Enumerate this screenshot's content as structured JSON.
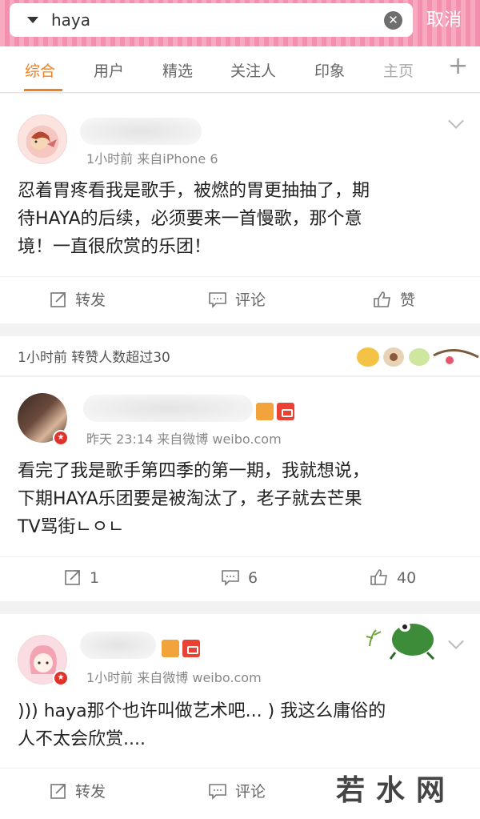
{
  "search": {
    "query": "haya",
    "cancel_label": "取消"
  },
  "tabs": [
    "综合",
    "用户",
    "精选",
    "关注人",
    "印象",
    "主页"
  ],
  "posts": [
    {
      "meta": "1小时前  来自iPhone 6",
      "text_lines": [
        "忍着胃疼看我是歌手，被燃的胃更抽抽了，期",
        "待HAYA的后续，必须要来一首慢歌，那个意",
        "境！一直很欣赏的乐团！"
      ],
      "actions": {
        "repost": "转发",
        "comment": "评论",
        "like": "赞"
      }
    },
    {
      "meta": "昨天 23:14  来自微博 weibo.com",
      "text_lines": [
        "看完了我是歌手第四季的第一期，我就想说，",
        "下期HAYA乐团要是被淘汰了，老子就去芒果",
        "TV骂街ㄴㅇㄴ"
      ],
      "actions": {
        "repost": "1",
        "comment": "6",
        "like": "40"
      }
    },
    {
      "meta": "1小时前  来自微博 weibo.com",
      "text_lines": [
        "))) haya那个也许叫做艺术吧... ) 我这么庸俗的",
        "人不太会欣赏...."
      ],
      "actions": {
        "repost": "转发",
        "comment": "评论"
      }
    }
  ],
  "repost_strip": {
    "text": "1小时前  转赞人数超过30"
  },
  "watermark": "若水网",
  "colors": {
    "accent": "#f08020",
    "header_pink": "#f48fb0",
    "badge_red": "#e94134"
  }
}
